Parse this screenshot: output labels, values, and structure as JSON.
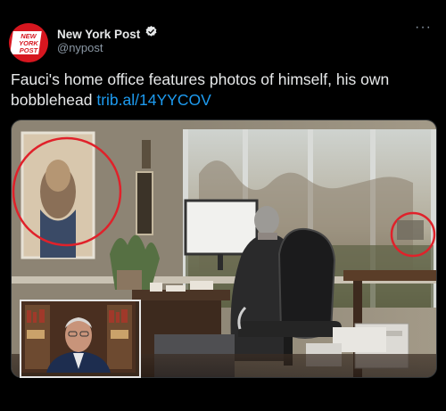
{
  "account": {
    "display_name": "New York Post",
    "handle": "@nypost",
    "verified": true,
    "avatar_text_line1": "NEW",
    "avatar_text_line2": "YORK",
    "avatar_text_line3": "POST",
    "avatar_color": "#d6161f"
  },
  "tweet": {
    "text_before_link": "Fauci's home office features photos of himself, his own bobblehead ",
    "link_text": "trib.al/14YYCOV"
  },
  "icons": {
    "verified": "verified-badge-icon",
    "more": "more-options-icon"
  },
  "colors": {
    "link": "#1d9bf0",
    "highlight_circle": "#e0212a"
  }
}
